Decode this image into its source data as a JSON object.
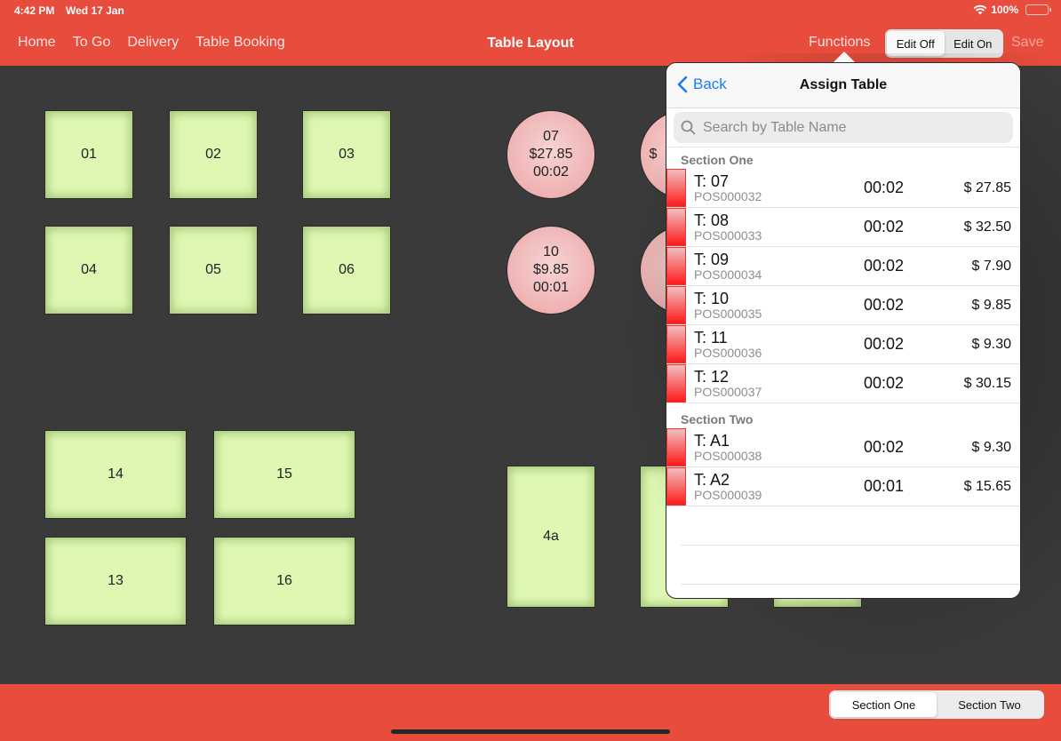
{
  "status_bar": {
    "time": "4:42 PM",
    "date": "Wed 17 Jan",
    "wifi_icon": "wifi-icon",
    "battery": "100%",
    "battery_icon": "battery-full-icon"
  },
  "header": {
    "nav": [
      {
        "label": "Home"
      },
      {
        "label": "To Go"
      },
      {
        "label": "Delivery"
      },
      {
        "label": "Table Booking"
      }
    ],
    "title": "Table Layout",
    "functions_label": "Functions",
    "edit_toggle": {
      "options": [
        "Edit Off",
        "Edit On"
      ],
      "selected": "Edit Off"
    },
    "save_label": "Save"
  },
  "layout": {
    "square_tables": [
      {
        "label": "01"
      },
      {
        "label": "02"
      },
      {
        "label": "03"
      },
      {
        "label": "04"
      },
      {
        "label": "05"
      },
      {
        "label": "06"
      },
      {
        "label": "14"
      },
      {
        "label": "15"
      },
      {
        "label": "13"
      },
      {
        "label": "16"
      },
      {
        "label": "4a"
      },
      {
        "label": ""
      },
      {
        "label": ""
      }
    ],
    "round_tables": [
      {
        "number": "07",
        "amount": "$27.85",
        "time": "00:02"
      },
      {
        "number": "",
        "amount": "$",
        "time": ""
      },
      {
        "number": "10",
        "amount": "$9.85",
        "time": "00:01"
      },
      {
        "number": "",
        "amount": "",
        "time": ""
      }
    ],
    "colors": {
      "free_table": "#def8b4",
      "occupied_table": "#efb2b2",
      "accent": "#e74c3c"
    }
  },
  "popover": {
    "back_label": "Back",
    "back_icon": "chevron-left-icon",
    "title": "Assign Table",
    "search": {
      "placeholder": "Search by Table Name",
      "value": "",
      "icon": "search-icon"
    },
    "sections": [
      {
        "name": "Section One",
        "rows": [
          {
            "table": "T: 07",
            "order": "POS000032",
            "time": "00:02",
            "amount": "$ 27.85"
          },
          {
            "table": "T: 08",
            "order": "POS000033",
            "time": "00:02",
            "amount": "$ 32.50"
          },
          {
            "table": "T: 09",
            "order": "POS000034",
            "time": "00:02",
            "amount": "$ 7.90"
          },
          {
            "table": "T: 10",
            "order": "POS000035",
            "time": "00:02",
            "amount": "$ 9.85"
          },
          {
            "table": "T: 11",
            "order": "POS000036",
            "time": "00:02",
            "amount": "$ 9.30"
          },
          {
            "table": "T: 12",
            "order": "POS000037",
            "time": "00:02",
            "amount": "$ 30.15"
          }
        ]
      },
      {
        "name": "Section Two",
        "rows": [
          {
            "table": "T: A1",
            "order": "POS000038",
            "time": "00:02",
            "amount": "$ 9.30"
          },
          {
            "table": "T: A2",
            "order": "POS000039",
            "time": "00:01",
            "amount": "$ 15.65"
          }
        ]
      }
    ]
  },
  "footer": {
    "section_toggle": {
      "options": [
        "Section One",
        "Section Two"
      ],
      "selected": "Section One"
    }
  }
}
